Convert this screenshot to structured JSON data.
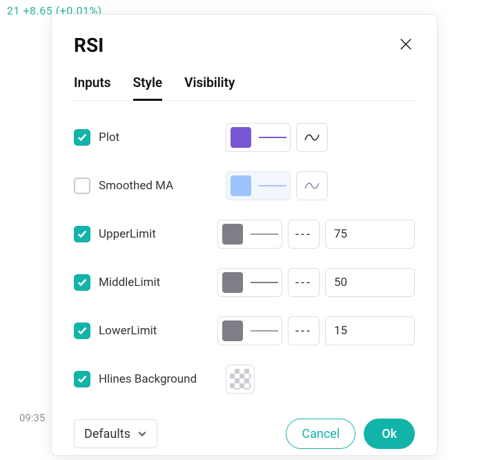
{
  "bg_price_text": "21 +8.65 (+0.01%)",
  "time_axis_label": "09:35",
  "dialog": {
    "title": "RSI",
    "tabs": {
      "inputs": "Inputs",
      "style": "Style",
      "visibility": "Visibility",
      "active": "style"
    },
    "rows": {
      "plot": {
        "label": "Plot",
        "checked": true,
        "color": "#7857d6"
      },
      "smoothed": {
        "label": "Smoothed MA",
        "checked": false,
        "color": "#9cc4fb"
      },
      "upper": {
        "label": "UpperLimit",
        "checked": true,
        "color": "#7d7e86",
        "dash": "---",
        "value": "75"
      },
      "middle": {
        "label": "MiddleLimit",
        "checked": true,
        "color": "#7d7e86",
        "dash": "---",
        "value": "50"
      },
      "lower": {
        "label": "LowerLimit",
        "checked": true,
        "color": "#7d7e86",
        "dash": "---",
        "value": "15"
      },
      "hlinesbg": {
        "label": "Hlines Background",
        "checked": true
      }
    },
    "footer": {
      "defaults": "Defaults",
      "cancel": "Cancel",
      "ok": "Ok"
    }
  }
}
